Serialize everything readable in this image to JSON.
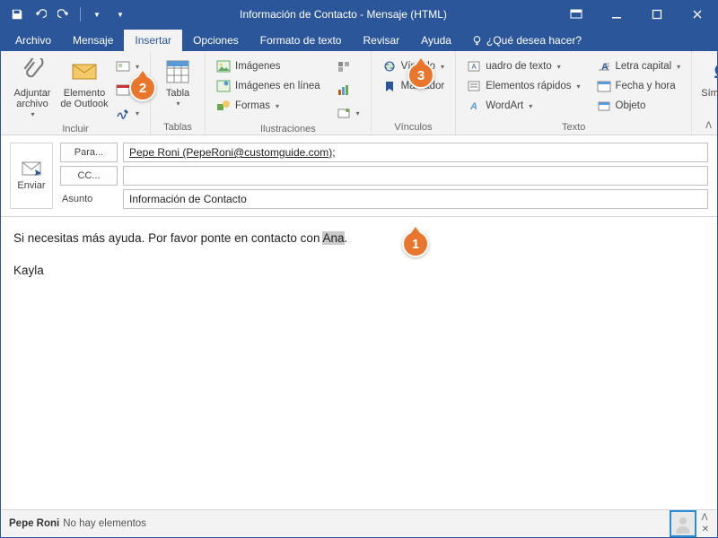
{
  "title": "Información de Contacto  -  Mensaje (HTML)",
  "menu": {
    "archivo": "Archivo",
    "mensaje": "Mensaje",
    "insertar": "Insertar",
    "opciones": "Opciones",
    "formato": "Formato de texto",
    "revisar": "Revisar",
    "ayuda": "Ayuda",
    "tellme": "¿Qué desea hacer?"
  },
  "ribbon": {
    "incluir": {
      "label": "Incluir",
      "adjuntar": "Adjuntar archivo",
      "elemento": "Elemento de Outlook"
    },
    "tablas": {
      "label": "Tablas",
      "tabla": "Tabla"
    },
    "ilustraciones": {
      "label": "Ilustraciones",
      "imagenes": "Imágenes",
      "imagenes_linea": "Imágenes en línea",
      "formas": "Formas"
    },
    "vinculos": {
      "label": "Vínculos",
      "vinculo": "Vínculo",
      "marcador": "Marcador"
    },
    "texto": {
      "label": "Texto",
      "cuadro": "uadro de texto",
      "elementos": "Elementos rápidos",
      "wordart": "WordArt",
      "letra": "Letra capital",
      "fecha": "Fecha y hora",
      "objeto": "Objeto"
    },
    "simbolos": {
      "label": "Símbolos"
    }
  },
  "compose": {
    "enviar": "Enviar",
    "para": "Para...",
    "cc": "CC...",
    "asunto_lbl": "Asunto",
    "to_value": "Pepe Roni (PepeRoni@customguide.com);",
    "subject_value": "Información de Contacto"
  },
  "body": {
    "line1a": "Si necesitas más ayuda. Por favor ponte en contacto con ",
    "sel": "Ana",
    "line1b": ".",
    "sig": "Kayla"
  },
  "status": {
    "name": "Pepe Roni",
    "msg": "No hay elementos"
  },
  "badges": {
    "b1": "1",
    "b2": "2",
    "b3": "3"
  }
}
